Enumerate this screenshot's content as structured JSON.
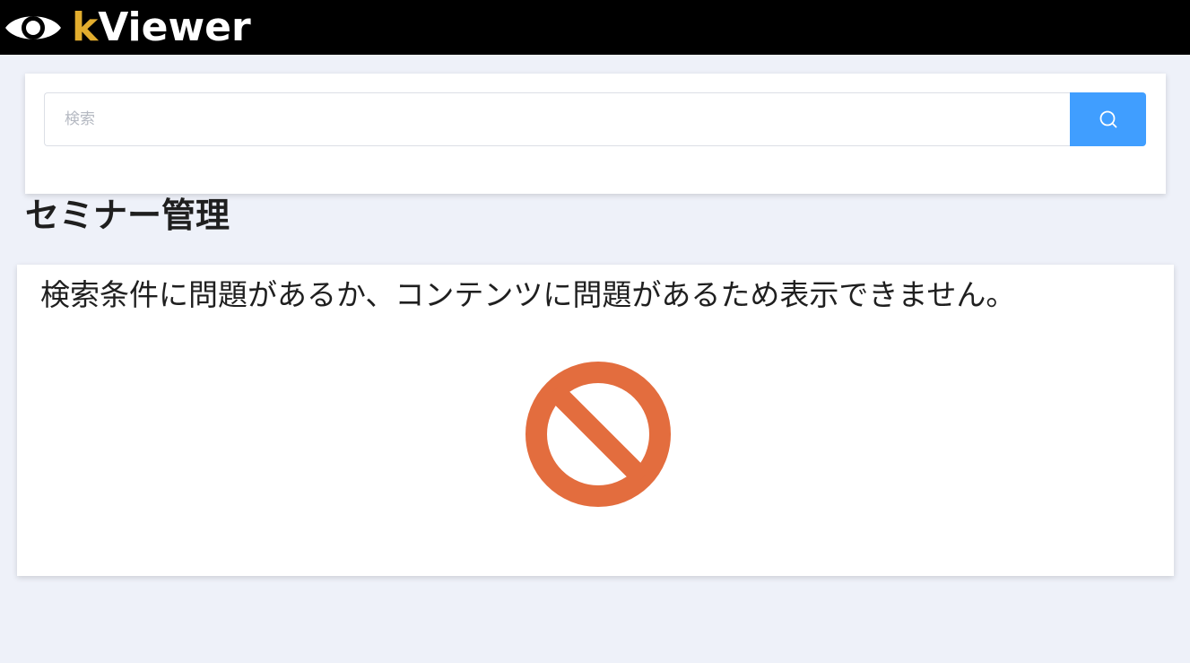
{
  "header": {
    "logo": {
      "first_letter": "k",
      "rest": "Viewer",
      "icon": "eye-icon",
      "accent_color": "#e2ad2e"
    }
  },
  "search": {
    "placeholder": "検索",
    "button_icon": "search-icon",
    "button_color": "#409eff"
  },
  "page": {
    "title": "セミナー管理"
  },
  "content": {
    "error_message": "検索条件に問題があるか、コンテンツに問題があるため表示できません。",
    "icon": "prohibited-icon",
    "icon_color": "#e36d3e"
  }
}
